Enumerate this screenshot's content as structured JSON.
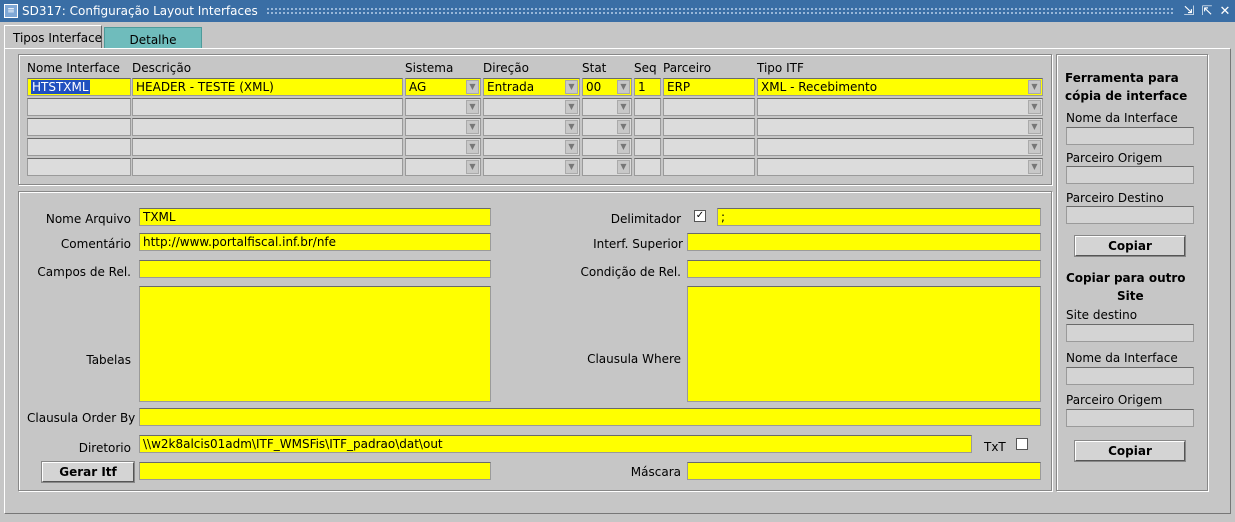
{
  "window": {
    "title": "SD317: Configuração Layout Interfaces",
    "app_icon": "oracle-forms-icon",
    "controls": [
      "minimize-icon",
      "maximize-icon",
      "close-icon"
    ]
  },
  "tabs": [
    {
      "label": "Tipos Interface",
      "active": true
    },
    {
      "label": "Detalhe",
      "active": false
    }
  ],
  "grid": {
    "headers": {
      "nome": "Nome Interface",
      "descricao": "Descrição",
      "sistema": "Sistema",
      "direcao": "Direção",
      "stat": "Stat",
      "seq": "Seq",
      "parceiro": "Parceiro",
      "tipo": "Tipo ITF"
    },
    "row1": {
      "nome": "HTSTXML",
      "descricao": "HEADER - TESTE (XML)",
      "sistema": "AG",
      "direcao": "Entrada",
      "stat": "00",
      "seq": "1",
      "parceiro": "ERP",
      "tipo": "XML - Recebimento"
    }
  },
  "detail": {
    "nome_arquivo": {
      "label": "Nome Arquivo",
      "value": "TXML"
    },
    "comentario": {
      "label": "Comentário",
      "value": "http://www.portalfiscal.inf.br/nfe"
    },
    "campos_rel": {
      "label": "Campos de Rel.",
      "value": ""
    },
    "tabelas": {
      "label": "Tabelas",
      "value": ""
    },
    "order_by": {
      "label": "Clausula Order By",
      "value": ""
    },
    "diretorio": {
      "label": "Diretorio",
      "value": "\\\\w2k8alcis01adm\\ITF_WMSFis\\ITF_padrao\\dat\\out"
    },
    "gerar_itf": {
      "label": "Gerar Itf",
      "value": ""
    },
    "delimitador": {
      "label": "Delimitador",
      "checked": true,
      "value": ";"
    },
    "interf_superior": {
      "label": "Interf. Superior",
      "value": ""
    },
    "condicao_rel": {
      "label": "Condição de Rel.",
      "value": ""
    },
    "clausula_where": {
      "label": "Clausula Where",
      "value": ""
    },
    "txt": {
      "label": "TxT",
      "checked": false
    },
    "mascara": {
      "label": "Máscara",
      "value": ""
    }
  },
  "side": {
    "copy_tool_title": "Ferramenta para cópia de interface",
    "nome_interface": "Nome da Interface",
    "parceiro_origem": "Parceiro Origem",
    "parceiro_destino": "Parceiro Destino",
    "copiar": "Copiar",
    "copy_site_title_1": "Copiar para outro",
    "copy_site_title_2": "Site",
    "site_destino": "Site destino",
    "nome_interface_2": "Nome da Interface",
    "parceiro_origem_2": "Parceiro Origem",
    "copiar_2": "Copiar"
  },
  "check_mark": "✓"
}
